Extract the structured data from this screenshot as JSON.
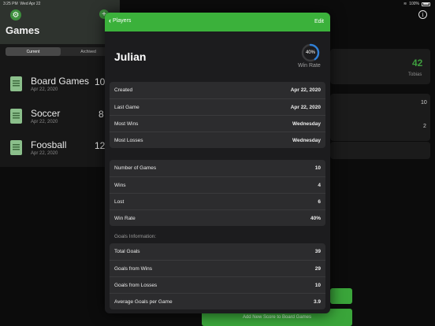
{
  "status_bar": {
    "time": "3:25 PM",
    "date": "Wed Apr 22",
    "battery": "100%"
  },
  "background": {
    "title": "Games",
    "segments": [
      "Current",
      "Archived"
    ],
    "games": [
      {
        "name": "Board Games",
        "date": "Apr 22, 2020",
        "count": "10"
      },
      {
        "name": "Soccer",
        "date": "Apr 22, 2020",
        "count": "8"
      },
      {
        "name": "Foosball",
        "date": "Apr 22, 2020",
        "count": "12"
      }
    ],
    "detail": {
      "big_number": "42",
      "player": "Tobias",
      "row_value_1": "10",
      "row_value_2": "2",
      "add_score_label": "Add New Score to Board Games"
    }
  },
  "sheet": {
    "back_label": "Players",
    "edit_label": "Edit",
    "player_name": "Julian",
    "win_rate_ring": {
      "label": "40%",
      "fraction": 0.4
    },
    "win_rate_caption": "Win Rate",
    "dates_group": [
      {
        "label": "Created",
        "value": "Apr 22, 2020"
      },
      {
        "label": "Last Game",
        "value": "Apr 22, 2020"
      },
      {
        "label": "Most Wins",
        "value": "Wednesday"
      },
      {
        "label": "Most Losses",
        "value": "Wednesday"
      }
    ],
    "stats_group": [
      {
        "label": "Number of Games",
        "value": "10"
      },
      {
        "label": "Wins",
        "value": "4"
      },
      {
        "label": "Lost",
        "value": "6"
      },
      {
        "label": "Win Rate",
        "value": "40%"
      }
    ],
    "goals_header": "Goals Information:",
    "goals_group": [
      {
        "label": "Total Goals",
        "value": "39"
      },
      {
        "label": "Goals from Wins",
        "value": "29"
      },
      {
        "label": "Goals from Losses",
        "value": "10"
      },
      {
        "label": "Average Goals per Game",
        "value": "3.9"
      }
    ]
  },
  "colors": {
    "accent": "#3bb13b",
    "ring": "#2f7fd6"
  }
}
